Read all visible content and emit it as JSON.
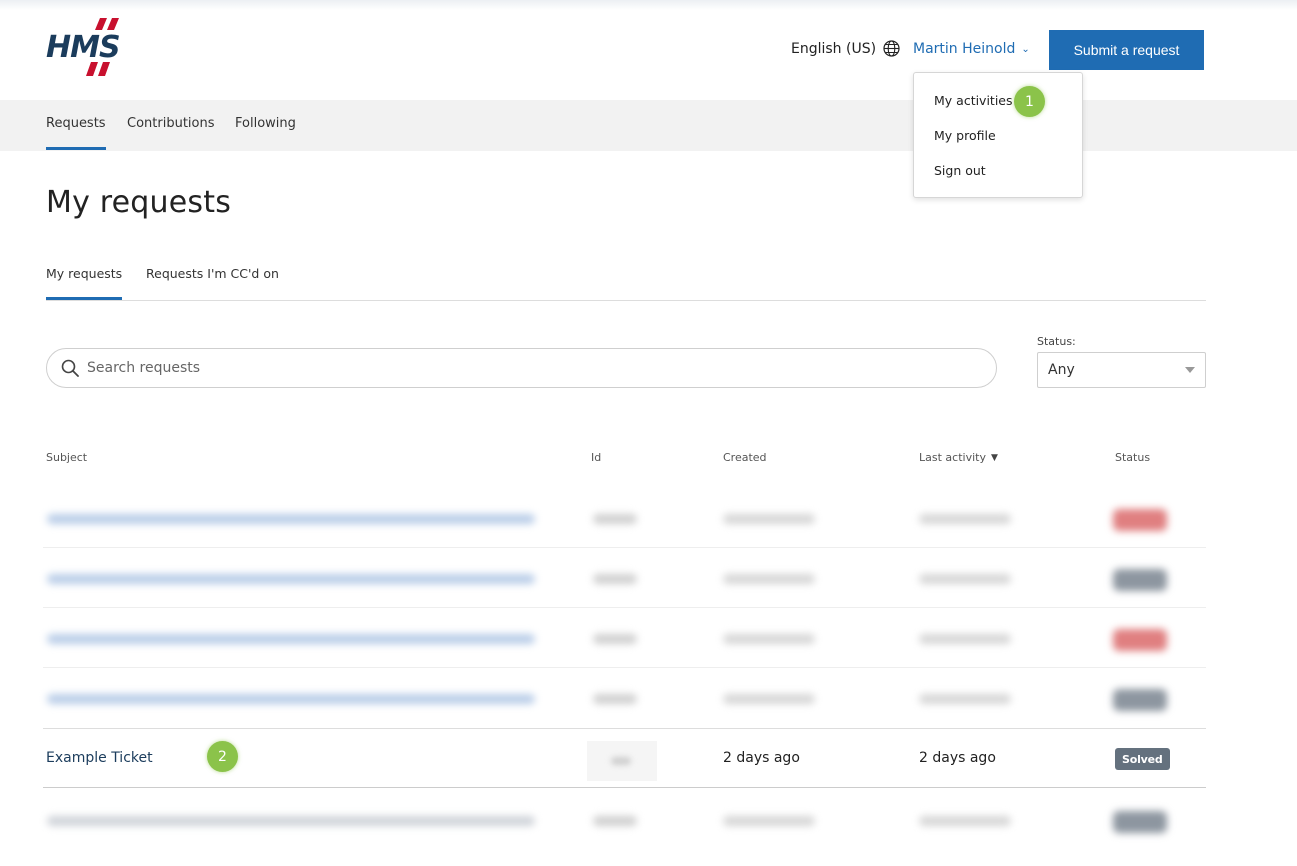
{
  "header": {
    "language": "English (US)",
    "user_name": "Martin Heinold",
    "submit_label": "Submit a request",
    "logo_text": "HMS"
  },
  "nav": {
    "tabs": [
      {
        "label": "Requests",
        "active": true
      },
      {
        "label": "Contributions",
        "active": false
      },
      {
        "label": "Following",
        "active": false
      }
    ]
  },
  "user_menu": {
    "items": [
      "My activities",
      "My profile",
      "Sign out"
    ]
  },
  "markers": [
    "1",
    "2"
  ],
  "page": {
    "title": "My requests",
    "subtabs": [
      {
        "label": "My requests",
        "active": true
      },
      {
        "label": "Requests I'm CC'd on",
        "active": false
      }
    ]
  },
  "search": {
    "placeholder": "Search requests"
  },
  "status_filter": {
    "label": "Status:",
    "selected": "Any"
  },
  "table": {
    "headers": {
      "subject": "Subject",
      "id": "Id",
      "created": "Created",
      "last_activity": "Last activity",
      "status": "Status"
    },
    "visible_row": {
      "subject": "Example Ticket",
      "created": "2 days ago",
      "last_activity": "2 days ago",
      "status": "Solved"
    }
  },
  "colors": {
    "accent": "#1f6cb3",
    "marker": "#8bc34a",
    "logo_blue": "#1b3c5c",
    "logo_red": "#c8102e",
    "badge_solved": "#64717e"
  }
}
